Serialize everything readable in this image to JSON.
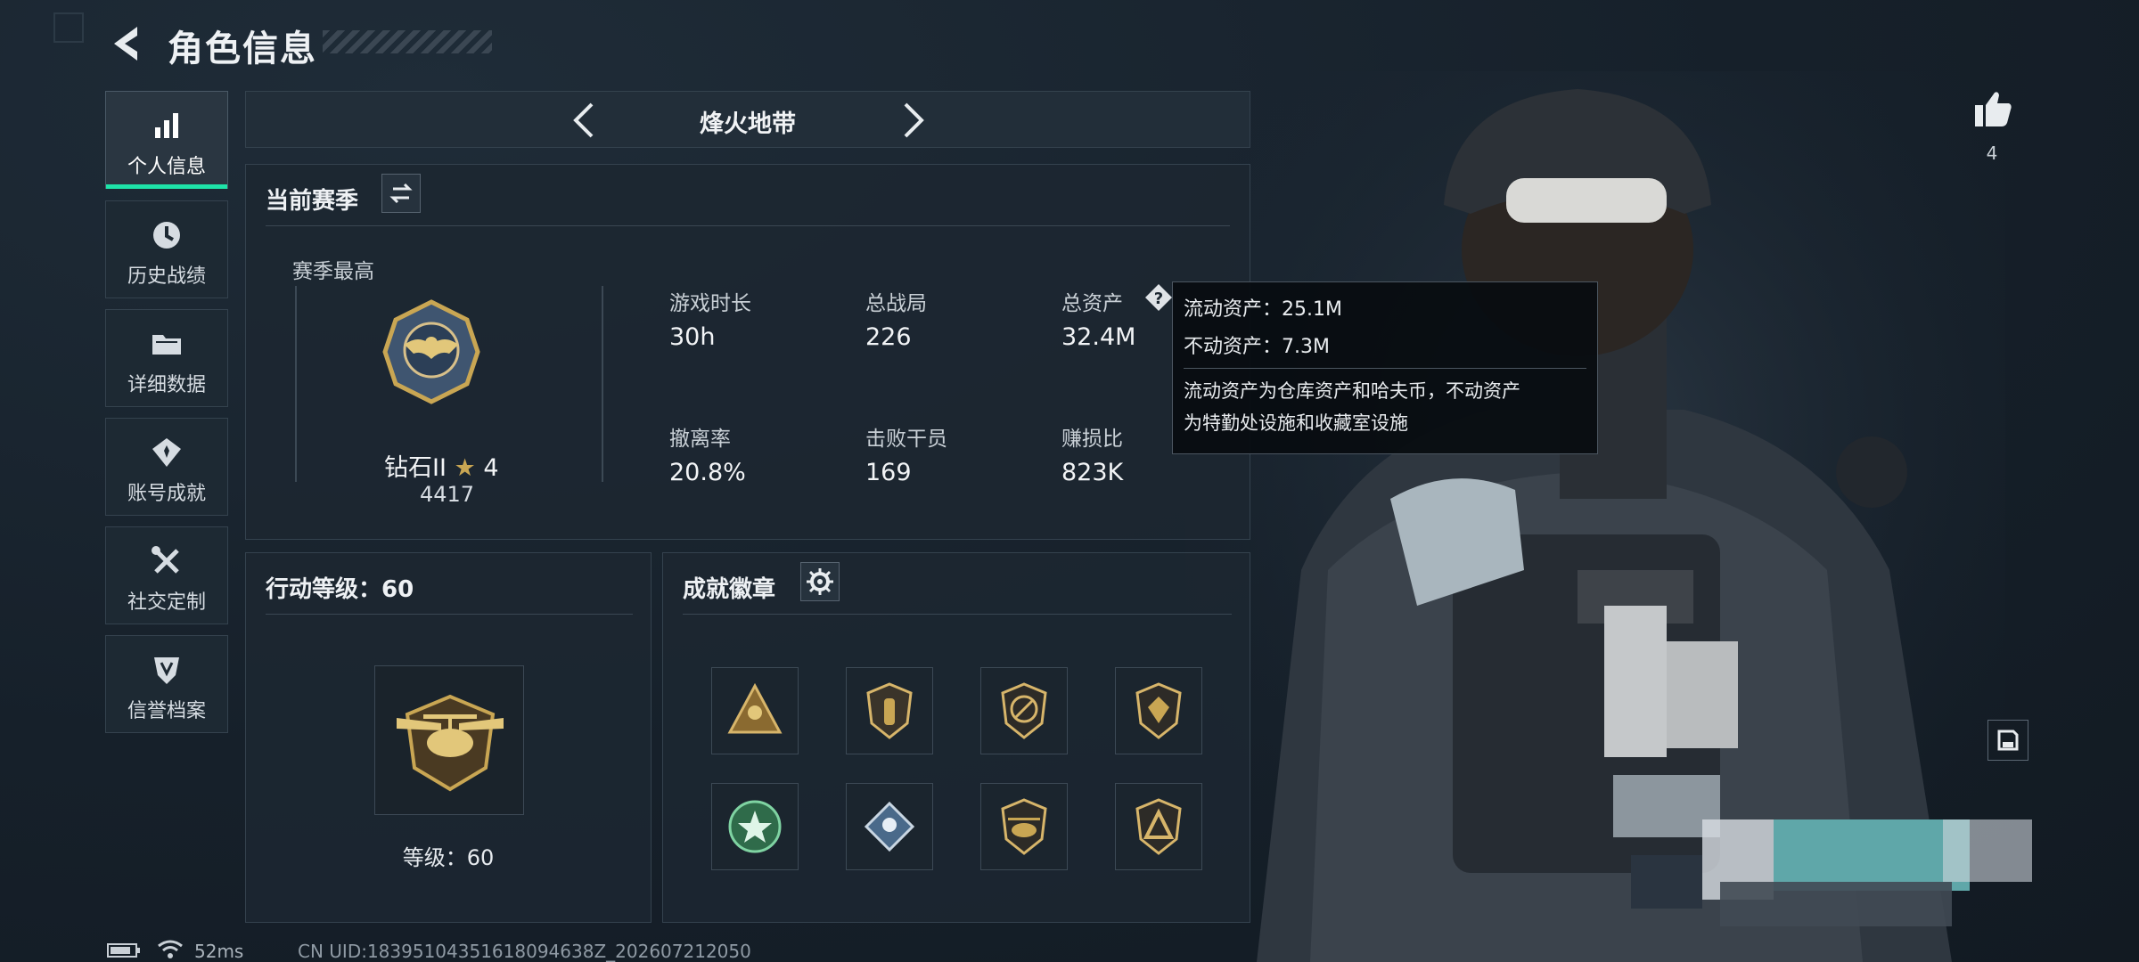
{
  "header": {
    "title": "角色信息"
  },
  "nav": {
    "items": [
      {
        "label": "个人信息",
        "icon": "bar-chart-icon",
        "active": true
      },
      {
        "label": "历史战绩",
        "icon": "clock-icon"
      },
      {
        "label": "详细数据",
        "icon": "folder-icon"
      },
      {
        "label": "账号成就",
        "icon": "achievement-icon"
      },
      {
        "label": "社交定制",
        "icon": "tools-icon"
      },
      {
        "label": "信誉档案",
        "icon": "shield-icon"
      }
    ]
  },
  "mode": {
    "label": "烽火地带"
  },
  "season": {
    "header": "当前赛季",
    "best_label": "赛季最高",
    "rank_name": "钻石II",
    "rank_stars": "4",
    "rank_score": "4417",
    "stats": [
      {
        "label": "游戏时长",
        "value": "30h"
      },
      {
        "label": "总战局",
        "value": "226"
      },
      {
        "label": "总资产",
        "value": "32.4M"
      },
      {
        "label": "撤离率",
        "value": "20.8%"
      },
      {
        "label": "击败干员",
        "value": "169"
      },
      {
        "label": "赚损比",
        "value": "823K"
      }
    ]
  },
  "tooltip": {
    "line1": "流动资产：25.1M",
    "line2": "不动资产：7.3M",
    "desc1": "流动资产为仓库资产和哈夫币，不动资产",
    "desc2": "为特勤处设施和收藏室设施"
  },
  "action_level": {
    "header": "行动等级：60",
    "level_text": "等级：60"
  },
  "badges": {
    "header": "成就徽章",
    "count": 8
  },
  "likes": {
    "count": "4"
  },
  "status_bar": {
    "ping": "52ms",
    "uid": "CN UID:18395104351618094638Z_202607212050"
  },
  "colors": {
    "accent": "#1ee3a8",
    "panel": "#1c2731",
    "border": "#34424e",
    "gold": "#c9a653"
  }
}
